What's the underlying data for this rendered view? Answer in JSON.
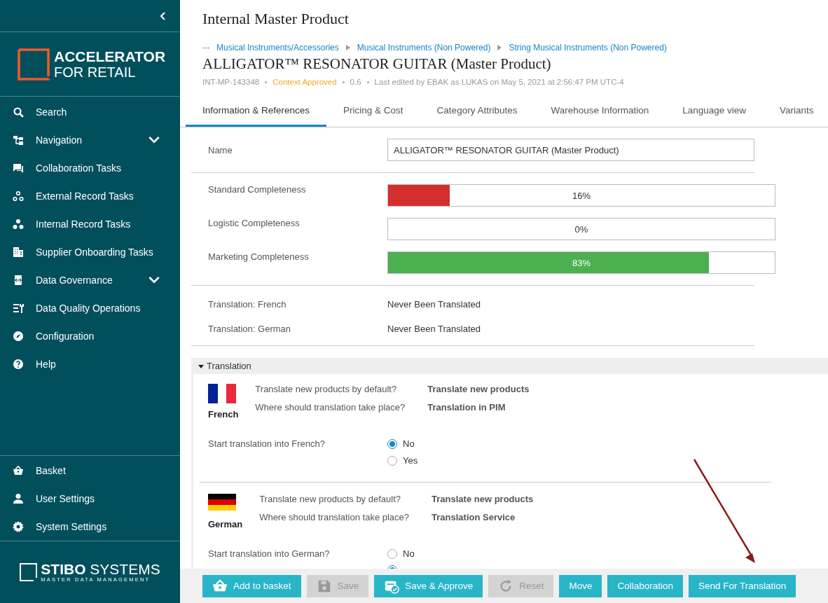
{
  "sidebar": {
    "logo": {
      "line1": "ACCELERATOR",
      "line2": "FOR RETAIL"
    },
    "items": [
      {
        "label": "Search",
        "has_submenu": false
      },
      {
        "label": "Navigation",
        "has_submenu": true
      },
      {
        "label": "Collaboration Tasks",
        "has_submenu": false
      },
      {
        "label": "External Record Tasks",
        "has_submenu": false
      },
      {
        "label": "Internal Record Tasks",
        "has_submenu": false
      },
      {
        "label": "Supplier Onboarding Tasks",
        "has_submenu": false
      },
      {
        "label": "Data Governance",
        "has_submenu": true
      },
      {
        "label": "Data Quality Operations",
        "has_submenu": false
      },
      {
        "label": "Configuration",
        "has_submenu": false
      },
      {
        "label": "Help",
        "has_submenu": false
      }
    ],
    "bottom_items": [
      {
        "label": "Basket"
      },
      {
        "label": "User Settings"
      },
      {
        "label": "System Settings"
      }
    ],
    "footer_logo": {
      "brand": "STIBO",
      "brand2": "SYSTEMS",
      "tagline": "MASTER DATA MANAGEMENT"
    }
  },
  "header": {
    "title": "Internal Master Product",
    "breadcrumbs": [
      "Musical Instruments/Accessories",
      "Musical Instruments (Non Powered)",
      "String Musical Instruments (Non Powered)"
    ],
    "product_name": "ALLIGATOR™ RESONATOR GUITAR (Master Product)",
    "meta": {
      "id": "INT-MP-143348",
      "status": "Context Approved",
      "version": "0.6",
      "edited": "Last edited by EBAK as LUKAS on May 5, 2021 at 2:56:47 PM UTC-4"
    }
  },
  "tabs": [
    {
      "label": "Information & References",
      "selected": true
    },
    {
      "label": "Pricing & Cost",
      "selected": false
    },
    {
      "label": "Category Attributes",
      "selected": false
    },
    {
      "label": "Warehouse Information",
      "selected": false
    },
    {
      "label": "Language view",
      "selected": false
    },
    {
      "label": "Variants",
      "selected": false
    }
  ],
  "name_field": {
    "label": "Name",
    "value": "ALLIGATOR™ RESONATOR GUITAR (Master Product)"
  },
  "completeness": [
    {
      "label": "Standard Completeness",
      "level": 0.16,
      "reading": "16%",
      "color": "#d32f2f"
    },
    {
      "label": "Logistic Completeness",
      "level": 0,
      "reading": "0%"
    },
    {
      "label": "Marketing Completeness",
      "level": 0.83,
      "reading": "83%",
      "color": "#4caf50"
    }
  ],
  "translation_status": [
    {
      "label": "Translation: French",
      "value": "Never Been Translated"
    },
    {
      "label": "Translation: German",
      "value": "Never Been Translated"
    }
  ],
  "translation_section": {
    "title": "Translation",
    "expanded": true,
    "languages": [
      {
        "name": "French",
        "questions": [
          {
            "question": "Translate new products by default?",
            "answer": "Translate new products"
          },
          {
            "question": "Where should translation take place?",
            "answer": "Translation in PIM"
          }
        ],
        "start_question": "Start translation into French?",
        "options": [
          {
            "label": "No",
            "selected": true
          },
          {
            "label": "Yes",
            "selected": false
          }
        ]
      },
      {
        "name": "German",
        "questions": [
          {
            "question": "Translate new products by default?",
            "answer": "Translate new products"
          },
          {
            "question": "Where should translation take place?",
            "answer": "Translation Service"
          }
        ],
        "start_question": "Start translation into German?",
        "options": [
          {
            "label": "No",
            "selected": false
          },
          {
            "selected": true
          }
        ]
      }
    ]
  },
  "toolbar": [
    {
      "label": "Add to basket",
      "disabled": false
    },
    {
      "label": "Save",
      "disabled": true
    },
    {
      "label": "Save & Approve",
      "disabled": false
    },
    {
      "label": "Reset",
      "disabled": true
    },
    {
      "label": "Move",
      "disabled": false
    },
    {
      "label": "Collaboration",
      "disabled": false
    },
    {
      "label": "Send For Translation",
      "disabled": false
    }
  ]
}
